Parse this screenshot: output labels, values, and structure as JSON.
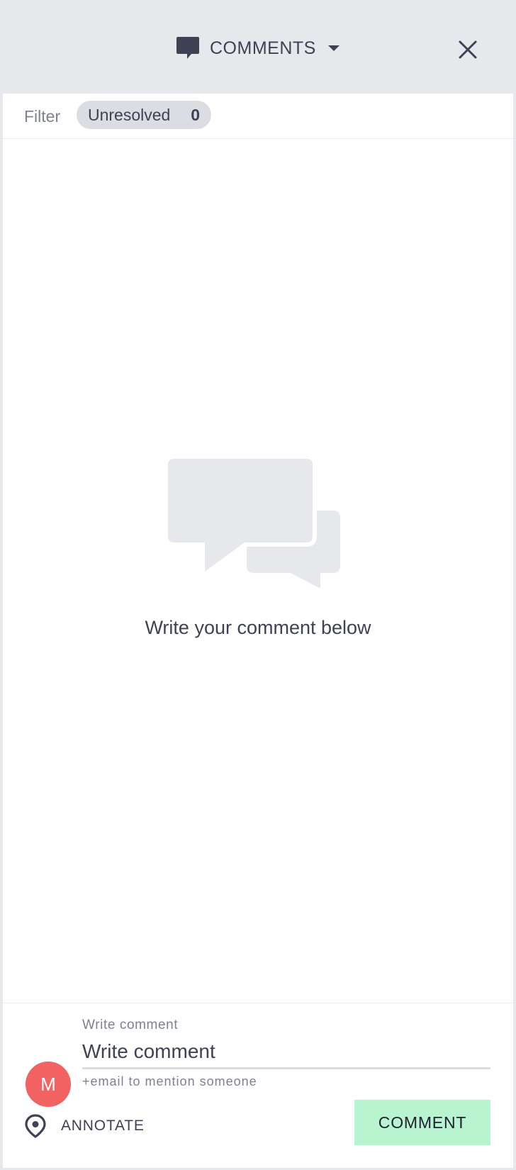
{
  "header": {
    "title": "COMMENTS",
    "title_icon": "chat-bubble-icon",
    "dropdown_icon": "caret-down-icon",
    "close_icon": "close-icon"
  },
  "filter": {
    "label": "Filter",
    "chip_label": "Unresolved",
    "chip_count": "0"
  },
  "empty_state": {
    "illustration_icon": "chat-bubbles-icon",
    "message": "Write your comment below"
  },
  "composer": {
    "avatar_initial": "M",
    "field_label": "Write comment",
    "input_placeholder": "Write comment",
    "input_value": "",
    "mention_hint": "+email to mention someone",
    "annotate_icon": "location-pin-icon",
    "annotate_label": "ANNOTATE",
    "submit_label": "COMMENT"
  },
  "colors": {
    "header_bg": "#e7e8eb",
    "panel_bg": "#ffffff",
    "text_primary": "#3f4254",
    "text_muted": "#7e8190",
    "chip_bg": "#dcdde2",
    "avatar_bg": "#f16363",
    "submit_bg": "#b8f4d0"
  }
}
